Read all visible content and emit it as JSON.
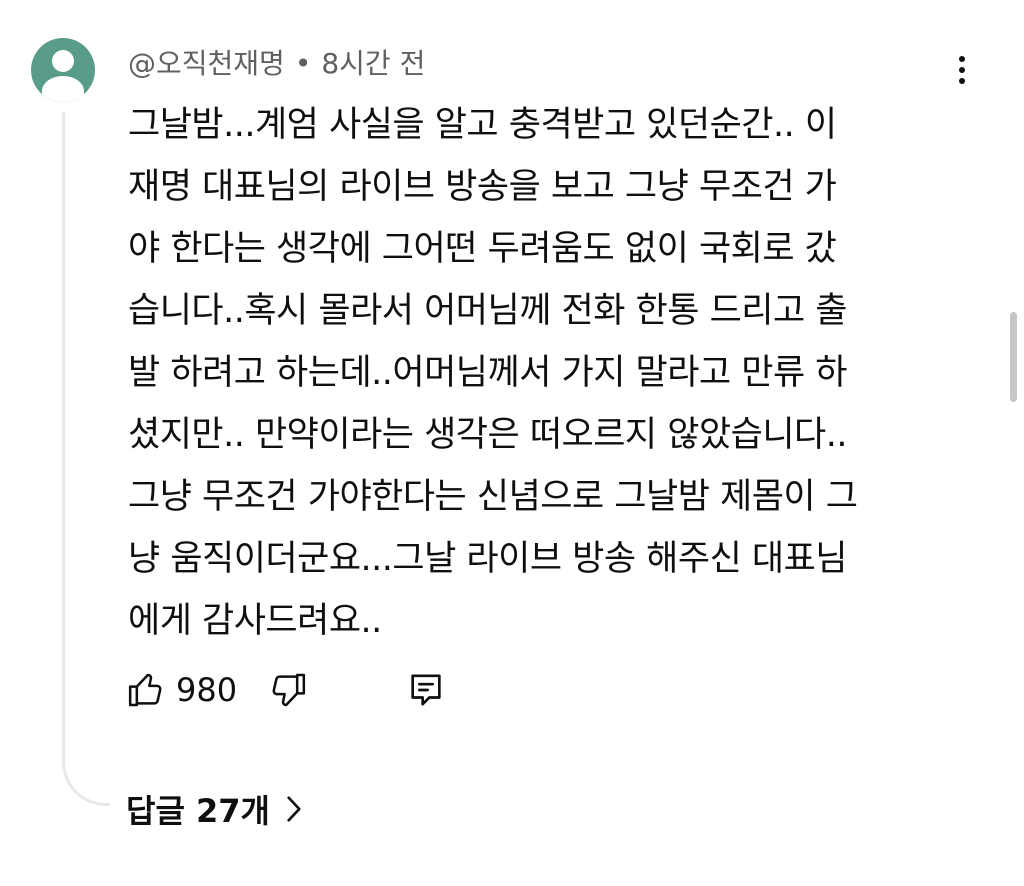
{
  "comment": {
    "author": "@오직천재명",
    "separator": "•",
    "time": "8시간 전",
    "text": "그날밤...계엄 사실을 알고 충격받고 있던순간.. 이\n재명 대표님의 라이브 방송을 보고 그냥 무조건 가\n야 한다는 생각에 그어떤 두려움도 없이 국회로 갔\n습니다..혹시 몰라서 어머님께 전화  한통 드리고 출\n발 하려고 하는데..어머님께서 가지 말라고 만류 하\n셨지만.. 만약이라는 생각은 떠오르지 않았습니다..\n그냥 무조건 가야한다는 신념으로 그날밤 제몸이 그\n냥 움직이더군요...그날 라이브 방송 해주신 대표님\n에게 감사드려요..",
    "like_count": "980",
    "replies_label": "답글 27개"
  },
  "icons": {
    "avatar": "default-user-avatar",
    "menu": "more-vertical-icon",
    "like": "thumbs-up-icon",
    "dislike": "thumbs-down-icon",
    "reply": "reply-comment-icon",
    "replies_chevron": "chevron-right-icon"
  },
  "colors": {
    "avatar_bg": "#5a9c8a",
    "meta_text": "#606060",
    "text": "#0f0f0f",
    "thread_line": "#e8e8e8"
  }
}
